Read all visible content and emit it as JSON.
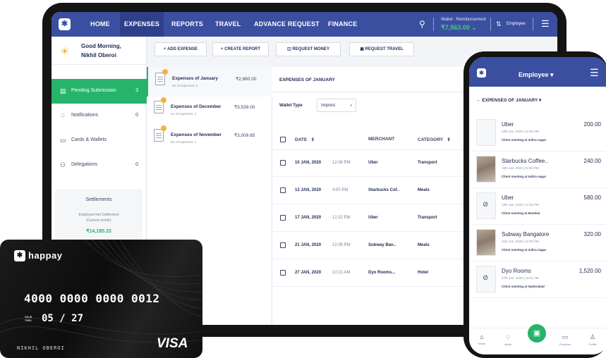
{
  "desktop": {
    "nav": {
      "logo_glyph": "✱",
      "items": [
        "HOME",
        "EXPENSES",
        "REPORTS",
        "TRAVEL",
        "ADVANCE REQUEST",
        "FINANCE"
      ],
      "active": "EXPENSES",
      "wallet_label": "Wallet : Reimbursement",
      "wallet_value": "₹7,563.00",
      "wallet_caret": "⌄",
      "employee_label": "Employee"
    },
    "greeting": {
      "line1": "Good Morning,",
      "line2": "Nikhil Oberoi"
    },
    "sidebar": [
      {
        "label": "Pending Submission",
        "count": "3",
        "icon": "document-icon"
      },
      {
        "label": "Notifications",
        "count": "0",
        "icon": "bell-icon"
      },
      {
        "label": "Cards & Wallets",
        "count": "",
        "icon": "wallet-icon"
      },
      {
        "label": "Delegations",
        "count": "0",
        "icon": "users-icon"
      }
    ],
    "settlements": {
      "title": "Settlements",
      "sub1": "Employee Net Settlement",
      "sub2": "(Current month)",
      "value": "₹14,185.33"
    },
    "actions": [
      "+ ADD EXPENSE",
      "+ CREATE REPORT",
      "REQUEST MONEY",
      "REQUEST TRAVEL"
    ],
    "expense_groups": [
      {
        "name": "Expenses of January",
        "sub": "No of expenses: 5",
        "amount": "₹2,960.00"
      },
      {
        "name": "Expenses of December",
        "sub": "No of expenses: 1",
        "amount": "₹3,539.00"
      },
      {
        "name": "Expenses of November",
        "sub": "No of expenses: 1",
        "amount": "₹3,009.65"
      }
    ],
    "main": {
      "title": "EXPENSES OF JANUARY",
      "wallet_type_label": "Wallet Type",
      "wallet_type_value": "Imprest",
      "headers": [
        "DATE",
        "MERCHANT",
        "CATEGORY"
      ],
      "sort_glyph": "⇕",
      "caret_glyph": "▾",
      "rows": [
        {
          "date": "10 JAN, 2020",
          "time": "12:06 PM",
          "merchant": "Uber",
          "category": "Transport"
        },
        {
          "date": "12 JAN, 2020",
          "time": "4:50 PM",
          "merchant": "Starbucks Cof..",
          "category": "Meals"
        },
        {
          "date": "17 JAN, 2020",
          "time": "12:32 PM",
          "merchant": "Uber",
          "category": "Transport"
        },
        {
          "date": "21 JAN, 2020",
          "time": "12:06 PM",
          "merchant": "Subway Ban..",
          "category": "Meals"
        },
        {
          "date": "27 JAN, 2020",
          "time": "10:21 AM",
          "merchant": "Dyo Rooms...",
          "category": "Hotel"
        }
      ]
    }
  },
  "phone": {
    "title": "Employee ▾",
    "logo_glyph": "✱",
    "menu_glyph": "☰",
    "crumb": "←   EXPENSES OF JANUARY ▾",
    "items": [
      {
        "name": "Uber",
        "date": "10th Jan, 2020 | 12:06 PM",
        "note": "Client meeting at Indira nagar",
        "amount": "200.00",
        "thumb": "receipt"
      },
      {
        "name": "Starbucks Coffee..",
        "date": "12th Jan, 2020 | 04:50 PM",
        "note": "Client meeting at Indira nagar",
        "amount": "240.00",
        "thumb": "photo"
      },
      {
        "name": "Uber",
        "date": "19th Jan, 2020 | 12:32 PM",
        "note": "Client meeting at Mumbai",
        "amount": "580.00",
        "thumb": "clip"
      },
      {
        "name": "Subway Bangalore",
        "date": "21th Jan, 2020 | 12:06 PM",
        "note": "Client meeting at Indira nagar",
        "amount": "320.00",
        "thumb": "photo"
      },
      {
        "name": "Dyo Rooms",
        "date": "27th Jan, 2020 | 10:21 AM",
        "note": "Client meeting at Hyderabad",
        "amount": "1,520.00",
        "thumb": "clip"
      }
    ],
    "tabs": [
      "Home",
      "Alerts",
      "",
      "Finances",
      "Profile"
    ],
    "tab_icons": [
      "⌂",
      "♢",
      "",
      "▭",
      "♙"
    ],
    "fab_glyph": "▣",
    "clip_glyph": "⊘"
  },
  "card": {
    "brand": "happay",
    "logo_glyph": "✱",
    "number": "4000 0000 0000 0012",
    "valid_1": "VALID",
    "valid_2": "THRU",
    "expiry": "05 / 27",
    "holder": "NIKHIL OBEROI",
    "network": "VISA"
  },
  "colors": {
    "primary": "#3b4fa0",
    "accent": "#27b36a",
    "wallet_value": "#3bd07a"
  }
}
